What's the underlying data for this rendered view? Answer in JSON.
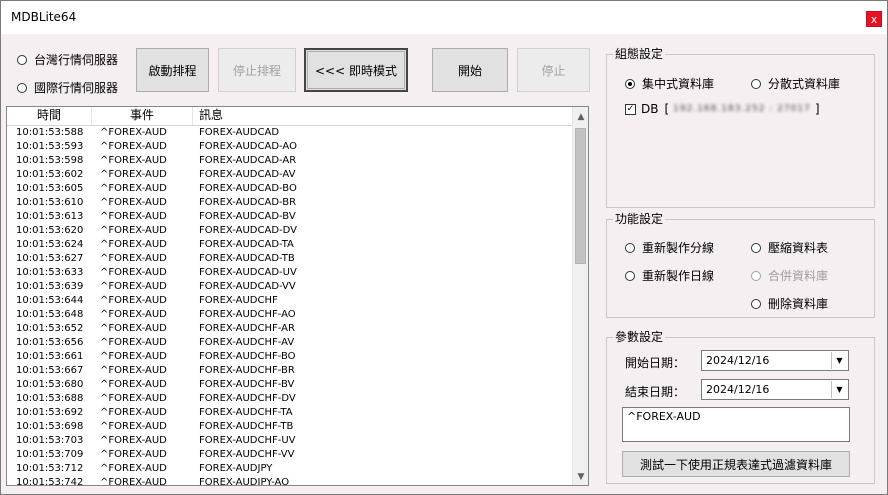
{
  "window": {
    "title": "MDBLite64",
    "close_label": "x"
  },
  "server_options": [
    {
      "label": "台灣行情伺服器",
      "selected": false
    },
    {
      "label": "國際行情伺服器",
      "selected": false
    }
  ],
  "toolbar": {
    "start_schedule": "啟動排程",
    "stop_schedule": "停止排程",
    "realtime_mode": "<<< 即時模式",
    "start": "開始",
    "stop": "停止"
  },
  "log": {
    "columns": [
      "時間",
      "事件",
      "訊息"
    ],
    "rows": [
      [
        "10:01:53:588",
        "^FOREX-AUD",
        "FOREX-AUDCAD"
      ],
      [
        "10:01:53:593",
        "^FOREX-AUD",
        "FOREX-AUDCAD-AO"
      ],
      [
        "10:01:53:598",
        "^FOREX-AUD",
        "FOREX-AUDCAD-AR"
      ],
      [
        "10:01:53:602",
        "^FOREX-AUD",
        "FOREX-AUDCAD-AV"
      ],
      [
        "10:01:53:605",
        "^FOREX-AUD",
        "FOREX-AUDCAD-BO"
      ],
      [
        "10:01:53:610",
        "^FOREX-AUD",
        "FOREX-AUDCAD-BR"
      ],
      [
        "10:01:53:613",
        "^FOREX-AUD",
        "FOREX-AUDCAD-BV"
      ],
      [
        "10:01:53:620",
        "^FOREX-AUD",
        "FOREX-AUDCAD-DV"
      ],
      [
        "10:01:53:624",
        "^FOREX-AUD",
        "FOREX-AUDCAD-TA"
      ],
      [
        "10:01:53:627",
        "^FOREX-AUD",
        "FOREX-AUDCAD-TB"
      ],
      [
        "10:01:53:633",
        "^FOREX-AUD",
        "FOREX-AUDCAD-UV"
      ],
      [
        "10:01:53:639",
        "^FOREX-AUD",
        "FOREX-AUDCAD-VV"
      ],
      [
        "10:01:53:644",
        "^FOREX-AUD",
        "FOREX-AUDCHF"
      ],
      [
        "10:01:53:648",
        "^FOREX-AUD",
        "FOREX-AUDCHF-AO"
      ],
      [
        "10:01:53:652",
        "^FOREX-AUD",
        "FOREX-AUDCHF-AR"
      ],
      [
        "10:01:53:656",
        "^FOREX-AUD",
        "FOREX-AUDCHF-AV"
      ],
      [
        "10:01:53:661",
        "^FOREX-AUD",
        "FOREX-AUDCHF-BO"
      ],
      [
        "10:01:53:667",
        "^FOREX-AUD",
        "FOREX-AUDCHF-BR"
      ],
      [
        "10:01:53:680",
        "^FOREX-AUD",
        "FOREX-AUDCHF-BV"
      ],
      [
        "10:01:53:688",
        "^FOREX-AUD",
        "FOREX-AUDCHF-DV"
      ],
      [
        "10:01:53:692",
        "^FOREX-AUD",
        "FOREX-AUDCHF-TA"
      ],
      [
        "10:01:53:698",
        "^FOREX-AUD",
        "FOREX-AUDCHF-TB"
      ],
      [
        "10:01:53:703",
        "^FOREX-AUD",
        "FOREX-AUDCHF-UV"
      ],
      [
        "10:01:53:709",
        "^FOREX-AUD",
        "FOREX-AUDCHF-VV"
      ],
      [
        "10:01:53:712",
        "^FOREX-AUD",
        "FOREX-AUDJPY"
      ],
      [
        "10:01:53:742",
        "^FOREX-AUD",
        "FOREX-AUDJPY-AO"
      ]
    ]
  },
  "config_group": {
    "label": "組態設定",
    "centralized": {
      "label": "集中式資料庫",
      "selected": true
    },
    "distributed": {
      "label": "分散式資料庫",
      "selected": false
    },
    "db_checkbox": {
      "label": "DB",
      "checked": true,
      "open_bracket": "[",
      "close_bracket": "]",
      "value_obscured": "192.168.183.252 : 27017"
    }
  },
  "function_group": {
    "label": "功能設定",
    "options": {
      "rebuild_minute": {
        "label": "重新製作分線",
        "selected": false,
        "enabled": true
      },
      "compress_table": {
        "label": "壓縮資料表",
        "selected": false,
        "enabled": true
      },
      "rebuild_daily": {
        "label": "重新製作日線",
        "selected": false,
        "enabled": true
      },
      "merge_db": {
        "label": "合併資料庫",
        "selected": false,
        "enabled": false
      },
      "delete_db": {
        "label": "刪除資料庫",
        "selected": false,
        "enabled": true
      }
    }
  },
  "param_group": {
    "label": "參數設定",
    "start_date_label": "開始日期：",
    "start_date": "2024/12/16",
    "end_date_label": "結束日期：",
    "end_date": "2024/12/16",
    "filter_text": "^FOREX-AUD",
    "test_button": "測試一下使用正規表達式過濾資料庫"
  }
}
